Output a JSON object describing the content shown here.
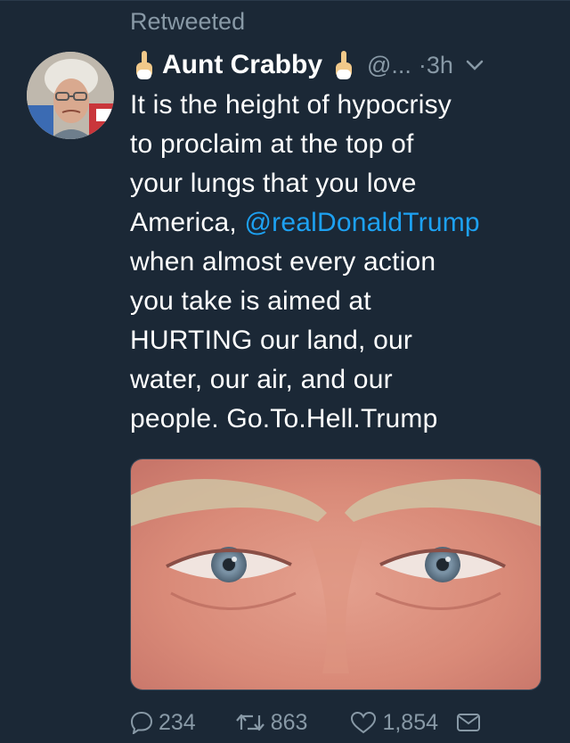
{
  "retweet_banner": "Retweeted",
  "author": {
    "display_name": "Aunt Crabby",
    "handle": "@...",
    "time": "·3h"
  },
  "tweet": {
    "lines": [
      "It is the height of hypocrisy",
      "to proclaim at the top of",
      "your lungs that you love"
    ],
    "line4_prefix": "America, ",
    "mention": "@realDonaldTrump",
    "lines_after": [
      "when almost every action",
      "you take is aimed at",
      "HURTING our land, our",
      "water, our air, and our",
      "people. Go.To.Hell.Trump"
    ]
  },
  "actions": {
    "reply_count": "234",
    "retweet_count": "863",
    "like_count": "1,854"
  },
  "icons": {
    "name_emoji": "middle-finger-emoji-icon",
    "caret": "chevron-down-icon",
    "reply": "reply-icon",
    "retweet": "retweet-icon",
    "like": "heart-icon",
    "dm": "envelope-icon"
  },
  "colors": {
    "background": "#1b2836",
    "muted": "#8899a6",
    "accent": "#1da1f2",
    "text": "#ffffff"
  }
}
